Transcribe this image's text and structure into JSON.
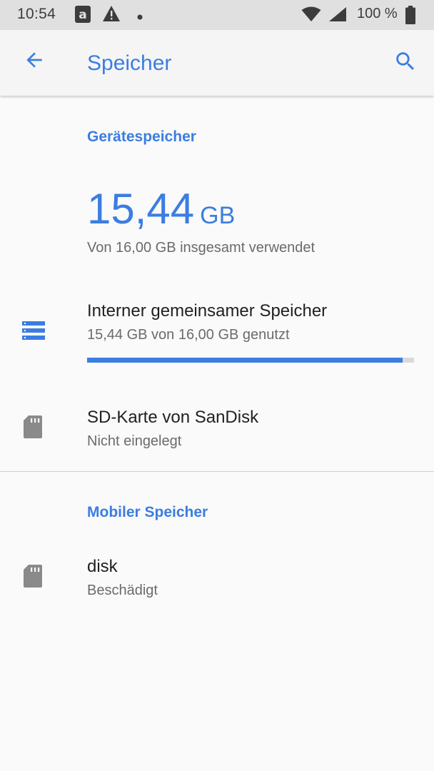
{
  "status_bar": {
    "time": "10:54",
    "battery_percent": "100 %"
  },
  "app_bar": {
    "title": "Speicher",
    "back_icon": "arrow-back-icon",
    "search_icon": "search-icon"
  },
  "device_storage": {
    "section_label": "Gerätespeicher",
    "used_value": "15,44",
    "used_unit": "GB",
    "summary": "Von 16,00 GB insgesamt verwendet"
  },
  "internal_storage": {
    "title": "Interner gemeinsamer Speicher",
    "subtitle": "15,44 GB von 16,00 GB genutzt",
    "usage_fraction": 0.965
  },
  "sd_card": {
    "title": "SD-Karte von SanDisk",
    "subtitle": "Nicht eingelegt"
  },
  "portable_storage": {
    "section_label": "Mobiler Speicher",
    "items": [
      {
        "title": "disk",
        "subtitle": "Beschädigt"
      }
    ]
  },
  "colors": {
    "accent": "#3b7de1",
    "icon_gray": "#8a8a8a"
  }
}
